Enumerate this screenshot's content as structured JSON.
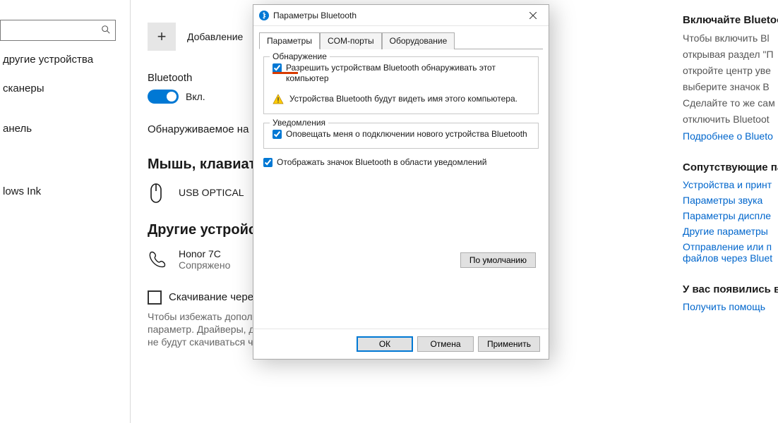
{
  "left_rail": {
    "search_placeholder": "",
    "items": [
      "другие устройства",
      "сканеры",
      "анель",
      "lows Ink"
    ]
  },
  "center": {
    "add_label": "Добавление",
    "bluetooth_label": "Bluetooth",
    "toggle_state": "Вкл.",
    "discoverable_text": "Обнаруживаемое на",
    "heading_mouse": "Мышь, клавиату",
    "mouse_device": "USB OPTICAL",
    "heading_other": "Другие устройс",
    "phone_device": "Honor 7C",
    "phone_status": "Сопряжено",
    "metered_label": "Скачивание через лимитные подключения",
    "metered_help": "Чтобы избежать дополнительных расходов, не включайте этот параметр. Драйверы, данные и приложения для новых устройств не будут скачиваться через лимитные подключения с"
  },
  "right": {
    "heading1": "Включайте Bluetoo",
    "para": [
      "Чтобы включить Bl",
      "открывая раздел \"П",
      "откройте центр уве",
      "выберите значок B",
      "Сделайте то же сам",
      "отключить Bluetoot"
    ],
    "link_more": "Подробнее о Blueto",
    "heading2": "Сопутствующие пар",
    "links2": [
      "Устройства и принт",
      "Параметры звука",
      "Параметры диспле",
      "Другие параметры",
      "Отправление или п\nфайлов через Bluet"
    ],
    "heading3": "У вас появились в",
    "link_help": "Получить помощь"
  },
  "dialog": {
    "title": "Параметры Bluetooth",
    "tabs": [
      "Параметры",
      "COM-порты",
      "Оборудование"
    ],
    "group_discovery": "Обнаружение",
    "discovery_cb": "Разрешить устройствам Bluetooth обнаруживать этот компьютер",
    "discovery_warn": "Устройства Bluetooth будут видеть имя этого компьютера.",
    "group_notify": "Уведомления",
    "notify_cb": "Оповещать меня о подключении нового устройства Bluetooth",
    "tray_cb": "Отображать значок Bluetooth в области уведомлений",
    "btn_defaults": "По умолчанию",
    "btn_ok": "ОК",
    "btn_cancel": "Отмена",
    "btn_apply": "Применить"
  }
}
